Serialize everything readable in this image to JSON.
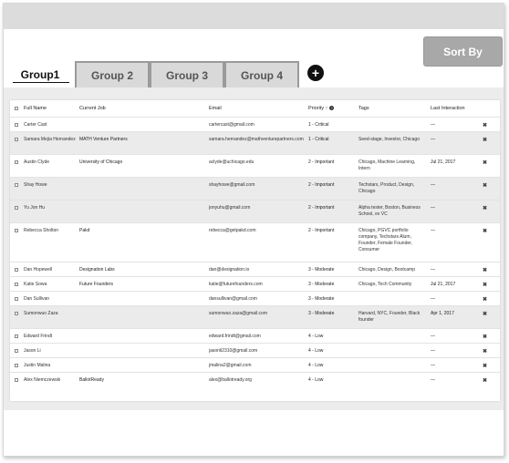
{
  "toolbar": {
    "sort_label": "Sort By"
  },
  "tabs": [
    {
      "label": "Group1"
    },
    {
      "label": "Group 2"
    },
    {
      "label": "Group 3"
    },
    {
      "label": "Group 4"
    }
  ],
  "add_tab_icon": "plus-circle-icon",
  "table": {
    "headers": {
      "name": "Full Name",
      "job": "Current Job",
      "email": "Email",
      "priority": "Priority",
      "tags": "Tags",
      "last": "Last Interaction"
    },
    "rows": [
      {
        "name": "Carter Cast",
        "job": "",
        "email": "cartercast@gmail.com",
        "priority": "1 - Critical",
        "tags": "",
        "last": "—"
      },
      {
        "name": "Samara Mejia Hernandez",
        "job": "MATH Venture Partners",
        "email": "samara.hernandez@mathventurepartners.com",
        "priority": "1 - Critical",
        "tags": "Seed-stage, Investor, Chicago",
        "last": "—"
      },
      {
        "name": "Austin Clyde",
        "job": "University of Chicago",
        "email": "aclyde@uchicago.edu",
        "priority": "2 - Important",
        "tags": "Chicago, Machine Learning, Intern",
        "last": "Jul 21, 2017"
      },
      {
        "name": "Shay Howe",
        "job": "",
        "email": "shayhowe@gmail.com",
        "priority": "2 - Important",
        "tags": "Techstars, Product, Design, Chicago",
        "last": "—"
      },
      {
        "name": "Yu Jon Hu",
        "job": "",
        "email": "jonyuhu@gmail.com",
        "priority": "2 - Important",
        "tags": "Alpha tester, Boston, Business School, ex VC",
        "last": "—"
      },
      {
        "name": "Rebecca Sholton",
        "job": "Pakd",
        "email": "rebecca@getpakd.com",
        "priority": "2 - Important",
        "tags": "Chicago, PGVC portfolio company, Techstars Alum, Founder, Female Founder, Consumer",
        "last": "—"
      },
      {
        "name": "Dan Hopewell",
        "job": "Designation Labs",
        "email": "dan@designation.io",
        "priority": "3 - Moderate",
        "tags": "Chicago, Design, Bootcamp",
        "last": "—"
      },
      {
        "name": "Katie Sowa",
        "job": "Future Founders",
        "email": "katie@futurefounders.com",
        "priority": "3 - Moderate",
        "tags": "Chicago, Tech Community",
        "last": "Jul 21, 2017"
      },
      {
        "name": "Dan Sullivan",
        "job": "",
        "email": "dansullivan@gmail.com",
        "priority": "3 - Moderate",
        "tags": "",
        "last": "—"
      },
      {
        "name": "Sumonwuo Zaza",
        "job": "",
        "email": "sumonwuo.zaza@gmail.com",
        "priority": "3 - Moderate",
        "tags": "Harvard, NYC, Founder, Black founder",
        "last": "Apr 1, 2017"
      },
      {
        "name": "Edward Frindt",
        "job": "",
        "email": "edward.frindt@gmail.com",
        "priority": "4 - Low",
        "tags": "",
        "last": "—"
      },
      {
        "name": "Jason Li",
        "job": "",
        "email": "jasonli2310@gmail.com",
        "priority": "4 - Low",
        "tags": "",
        "last": "—"
      },
      {
        "name": "Justin Malina",
        "job": "",
        "email": "jmalina2@gmail.com",
        "priority": "4 - Low",
        "tags": "",
        "last": "—"
      },
      {
        "name": "Alex Niemczewski",
        "job": "BallotReady",
        "email": "alex@ballotready.org",
        "priority": "4 - Low",
        "tags": "",
        "last": "—"
      }
    ],
    "delete_glyph": "✖"
  }
}
